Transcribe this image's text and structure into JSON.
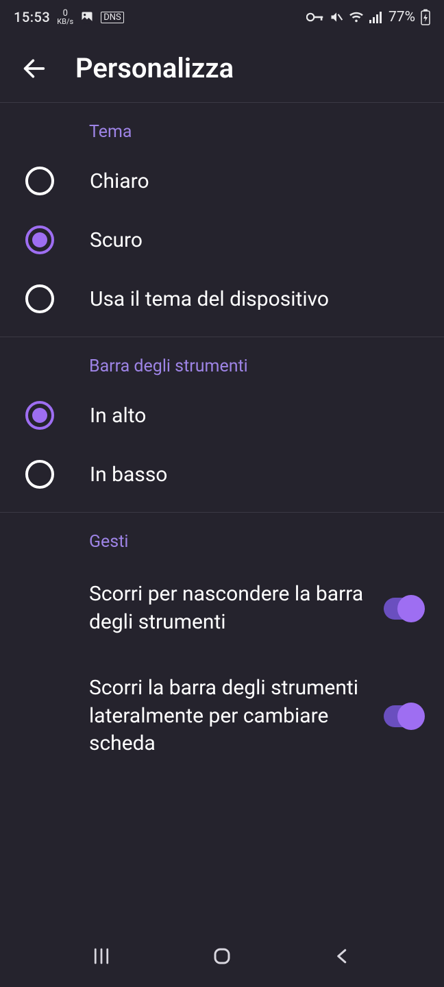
{
  "status": {
    "time": "15:53",
    "kbs_top": "0",
    "kbs_bottom": "KB/s",
    "dns": "DNS",
    "battery": "77%"
  },
  "header": {
    "title": "Personalizza"
  },
  "sections": {
    "theme": {
      "title": "Tema",
      "options": [
        {
          "label": "Chiaro",
          "selected": false
        },
        {
          "label": "Scuro",
          "selected": true
        },
        {
          "label": "Usa il tema del dispositivo",
          "selected": false
        }
      ]
    },
    "toolbar": {
      "title": "Barra degli strumenti",
      "options": [
        {
          "label": "In alto",
          "selected": true
        },
        {
          "label": "In basso",
          "selected": false
        }
      ]
    },
    "gestures": {
      "title": "Gesti",
      "toggles": [
        {
          "label": "Scorri per nascondere la barra degli strumenti",
          "on": true
        },
        {
          "label": "Scorri la barra degli strumenti lateralmente per cambiare scheda",
          "on": true
        }
      ]
    }
  },
  "accent": "#9e6ef2",
  "bg": "#25232d"
}
